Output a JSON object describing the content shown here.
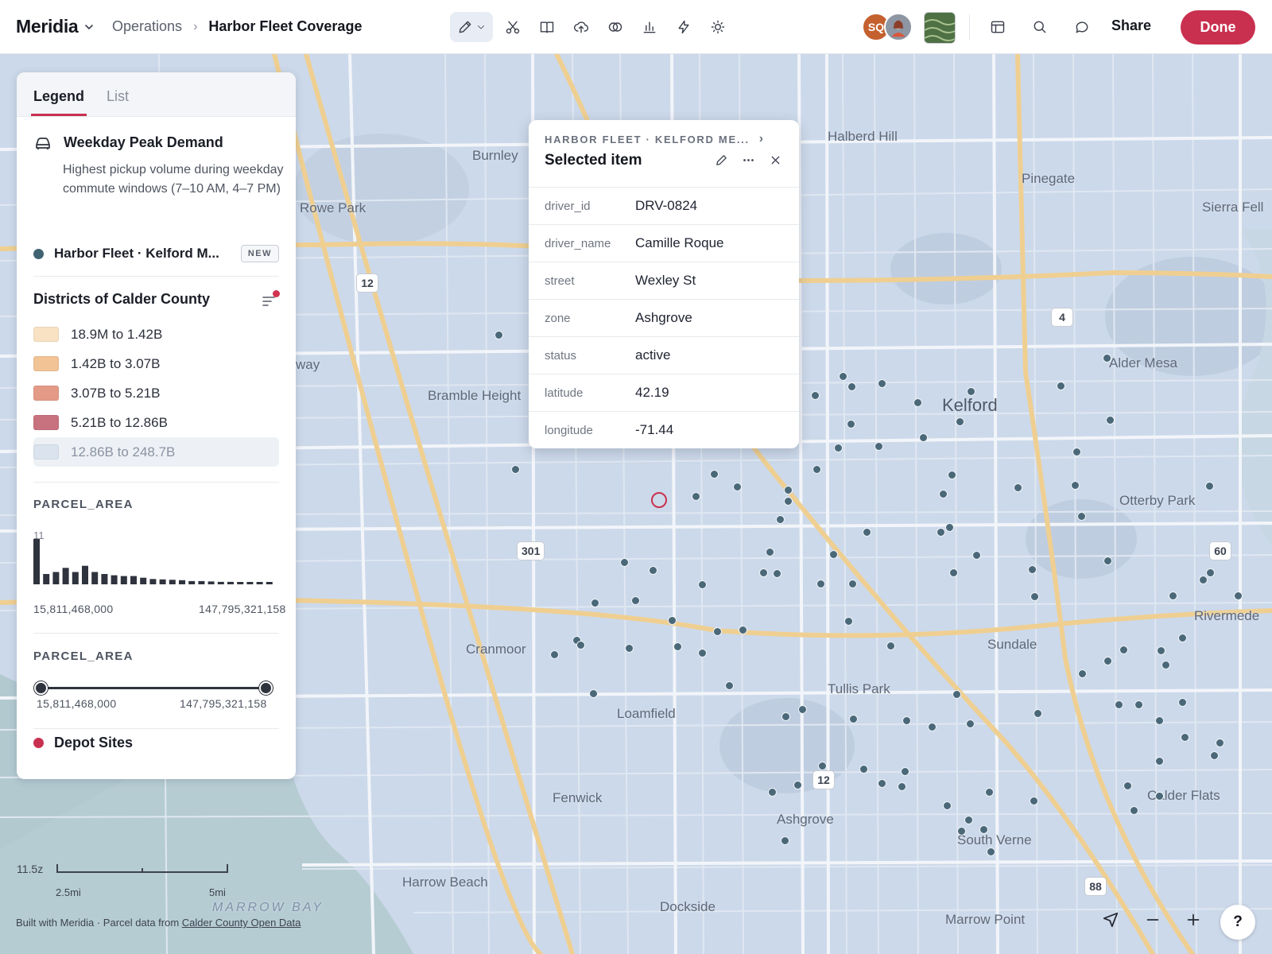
{
  "app": {
    "brand": "Meridia",
    "breadcrumb_parent": "Operations",
    "breadcrumb_current": "Harbor Fleet Coverage"
  },
  "toolbar": {
    "tools": [
      "pencil-icon",
      "scissors-icon",
      "book-icon",
      "cloud-upload-icon",
      "overlap-icon",
      "bar-chart-icon",
      "bolt-icon",
      "sun-icon"
    ]
  },
  "collaborators": [
    {
      "initials": "SQ",
      "color": "#c4612f"
    },
    {
      "initials": "",
      "color": "#8e95a3"
    }
  ],
  "header_actions": {
    "share_label": "Share",
    "done_label": "Done"
  },
  "legend": {
    "tabs": [
      "Legend",
      "List"
    ],
    "active_tab": "Legend",
    "layer_title": "Weekday Peak Demand",
    "layer_description": "Highest pickup volume during weekday commute windows (7–10 AM, 4–7 PM)",
    "fleet_layer": "Harbor Fleet · Kelford M...",
    "fleet_badge": "NEW",
    "districts_title": "Districts of Calder County",
    "classes": [
      {
        "label": "18.9M to 1.42B",
        "color": "#f8e2c3"
      },
      {
        "label": "1.42B to 3.07B",
        "color": "#f1c395"
      },
      {
        "label": "3.07B to 5.21B",
        "color": "#e39a86"
      },
      {
        "label": "5.21B to 12.86B",
        "color": "#c8727f"
      },
      {
        "label": "12.86B to 248.7B",
        "color": "#dbe4ee"
      }
    ],
    "histogram": {
      "label": "PARCEL_AREA",
      "max_count": "11",
      "counts": [
        11,
        2.5,
        3,
        4,
        3,
        4.5,
        3,
        2.5,
        2.2,
        2,
        2,
        1.6,
        1.3,
        1.2,
        1.1,
        1,
        0.8,
        0.8,
        0.7,
        0.6,
        0.6,
        0.5,
        0.5,
        0.5,
        0.5
      ],
      "min": "15,811,468,000",
      "max": "147,795,321,158"
    },
    "range_filter": {
      "label": "PARCEL_AREA",
      "min": "15,811,468,000",
      "max": "147,795,321,158",
      "selected_fraction": [
        0,
        1
      ]
    },
    "depot_layer": "Depot Sites"
  },
  "popup": {
    "breadcrumb": "HARBOR FLEET · KELFORD ME...",
    "title": "Selected item",
    "attributes": [
      {
        "key": "driver_id",
        "value": "DRV-0824"
      },
      {
        "key": "driver_name",
        "value": "Camille Roque"
      },
      {
        "key": "street",
        "value": "Wexley St"
      },
      {
        "key": "zone",
        "value": "Ashgrove"
      },
      {
        "key": "status",
        "value": "active"
      },
      {
        "key": "latitude",
        "value": "42.19"
      },
      {
        "key": "longitude",
        "value": "-71.44"
      }
    ]
  },
  "map": {
    "places": [
      "Burnley",
      "Halberd Hill",
      "Pinegate",
      "Sierra Fell",
      "Rowe Park",
      "Alder Mesa",
      "Kelford",
      "Bramble Height",
      "way",
      "Otterby Park",
      "Rivermede",
      "Cranmoor",
      "Sundale",
      "Tullis Park",
      "Loamfield",
      "Fenwick",
      "Calder Flats",
      "Ashgrove",
      "South Verne",
      "Harrow Beach",
      "Dockside",
      "Marrow Point",
      "MARROW BAY"
    ],
    "route_shields": [
      "12",
      "4",
      "301",
      "60",
      "12",
      "88"
    ],
    "zoom_level": "11.5z",
    "scale_labels": [
      "2.5mi",
      "5mi"
    ],
    "attribution_prefix": "Built with Meridia · Parcel data from ",
    "attribution_link": "Calder County Open Data",
    "help_label": "?"
  }
}
